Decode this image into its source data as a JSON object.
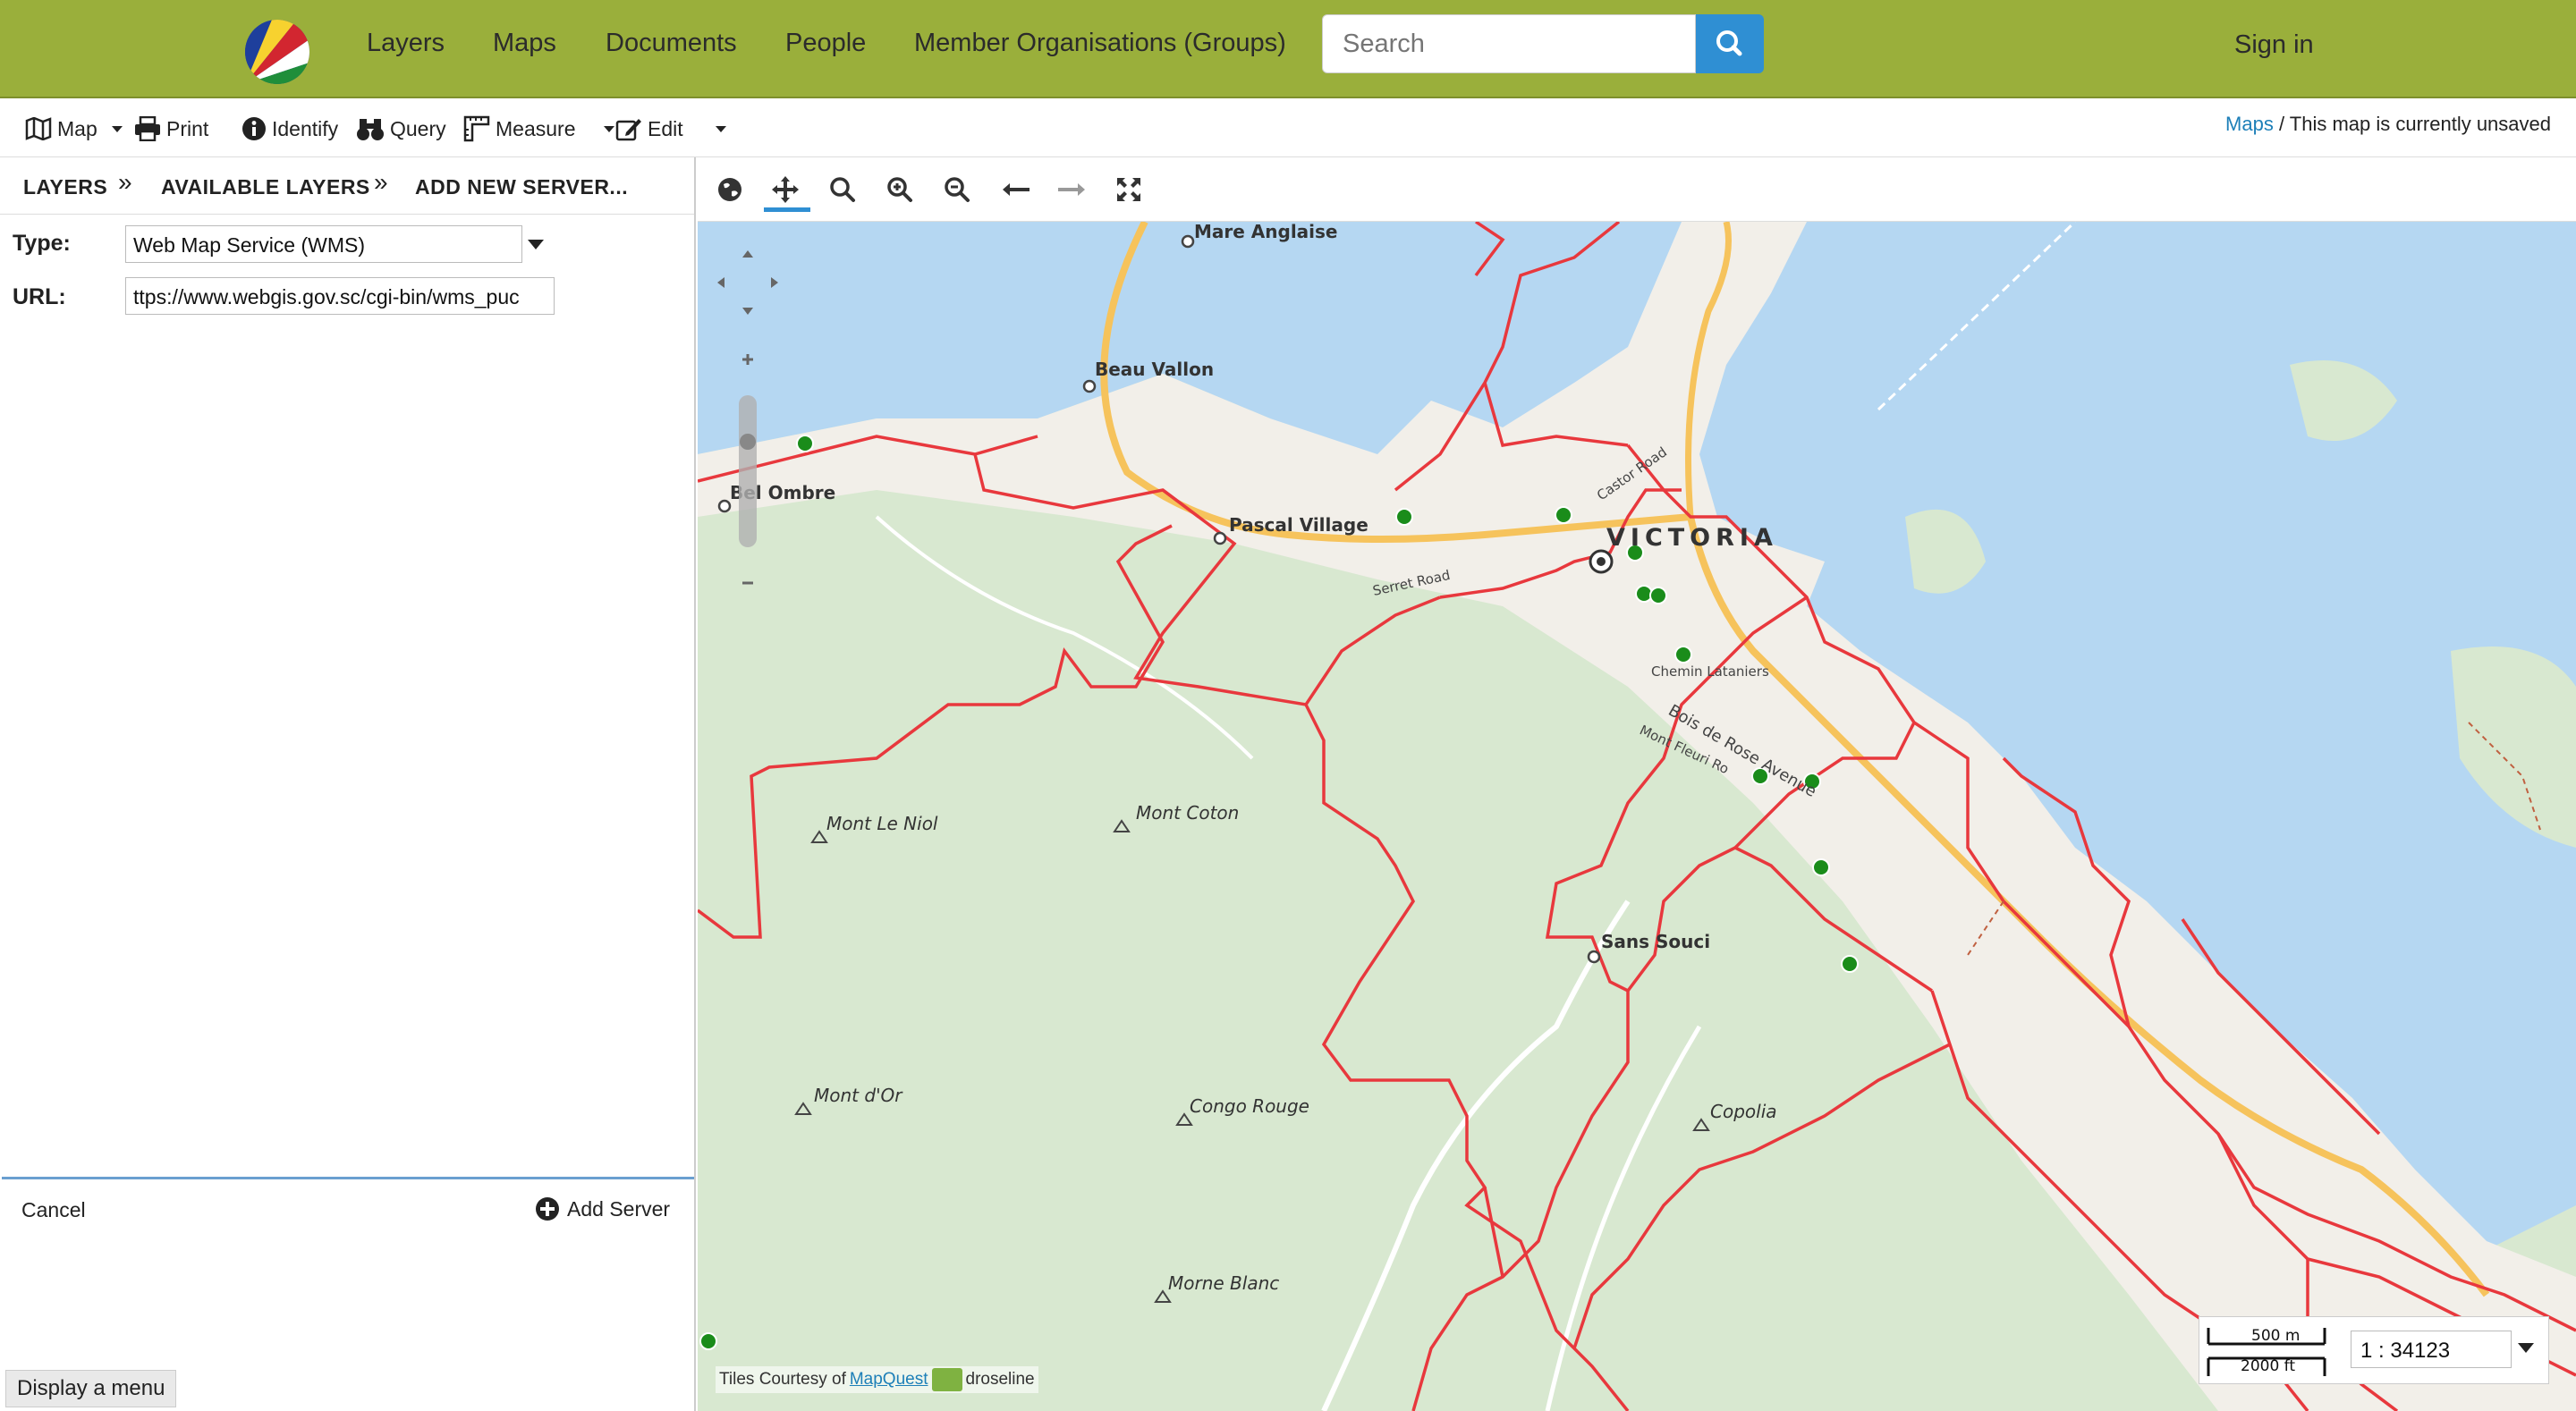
{
  "nav": {
    "links": [
      "Layers",
      "Maps",
      "Documents",
      "People",
      "Member Organisations (Groups)"
    ],
    "search_placeholder": "Search",
    "signin": "Sign in"
  },
  "toolbar": {
    "map": "Map",
    "print": "Print",
    "identify": "Identify",
    "query": "Query",
    "measure": "Measure",
    "edit": "Edit"
  },
  "breadcrumb": {
    "maps_link": "Maps",
    "status": " / This map is currently unsaved"
  },
  "panel": {
    "tabs": [
      "LAYERS",
      "AVAILABLE LAYERS",
      "ADD NEW SERVER..."
    ],
    "separator": "»",
    "type_label": "Type:",
    "type_value": "Web Map Service (WMS)",
    "url_label": "URL:",
    "url_value": "ttps://www.webgis.gov.sc/cgi-bin/wms_puc",
    "cancel": "Cancel",
    "add_server": "Add Server",
    "tooltip": "Display a menu"
  },
  "map": {
    "place_labels": [
      "Mare Anglaise",
      "Beau Vallon",
      "Bel Ombre",
      "Pascal Village",
      "VICTORIA",
      "Mont Le Niol",
      "Mont Coton",
      "Sans Souci",
      "Mont d'Or",
      "Congo Rouge",
      "Copolia",
      "Morne Blanc"
    ],
    "road_labels": [
      "Castor Road",
      "Serret Road",
      "Chemin Lataniers",
      "Bois de Rose Avenue",
      "Mont Fleuri Ro"
    ],
    "scale_m": "500 m",
    "scale_ft": "2000 ft",
    "scale_ratio": "1 : 34123",
    "attribution_prefix": "Tiles Courtesy of",
    "attribution_link": "MapQuest",
    "attribution_suffix": "droseline"
  },
  "colors": {
    "topnav": "#9aaf3b",
    "sea": "#b5d7f2",
    "land": "#f2efe9",
    "park": "#d8e8d0",
    "boundary": "#e8383d",
    "road": "#f6c35c",
    "marker": "#1a8c1a",
    "accent": "#2f8fd3"
  }
}
